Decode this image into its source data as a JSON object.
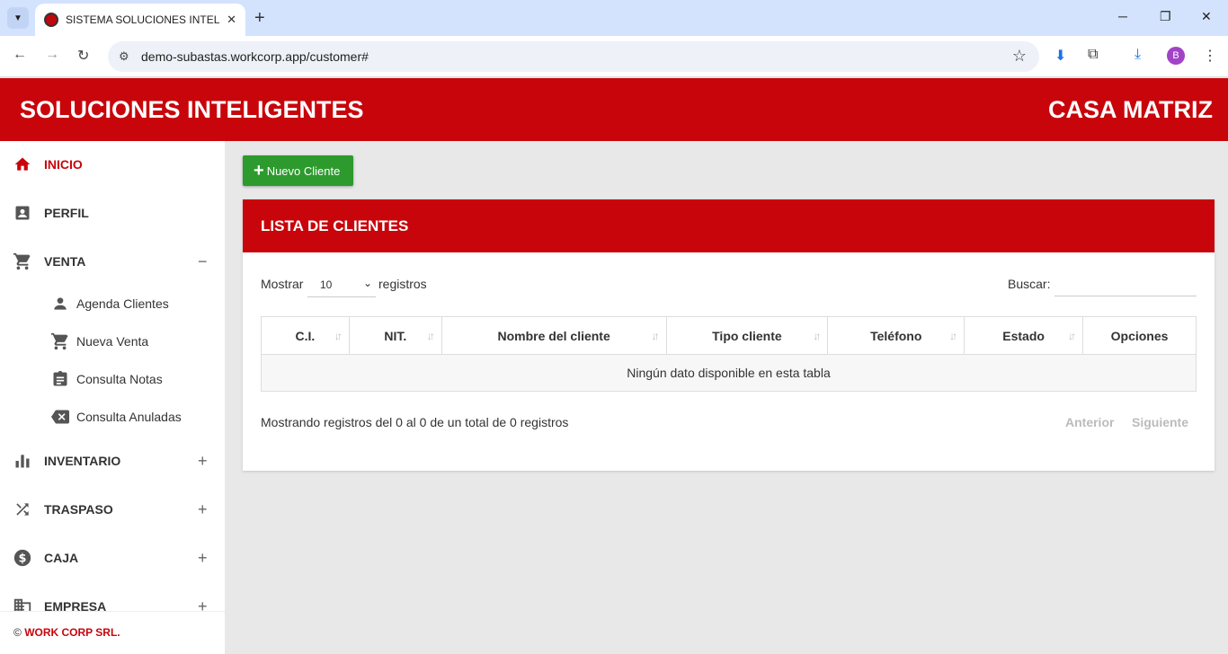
{
  "browser": {
    "tab_title": "SISTEMA SOLUCIONES INTELIGENTES",
    "url": "demo-subastas.workcorp.app/customer#",
    "profile_initial": "B"
  },
  "header": {
    "brand": "SOLUCIONES INTELIGENTES",
    "branch": "CASA MATRIZ",
    "accent_color": "#c8050b"
  },
  "sidebar": {
    "items": [
      {
        "label": "INICIO",
        "icon": "home-icon",
        "active": true
      },
      {
        "label": "PERFIL",
        "icon": "profile-card-icon"
      },
      {
        "label": "VENTA",
        "icon": "cart-icon",
        "toggle": "−",
        "children": [
          {
            "label": "Agenda Clientes",
            "icon": "person-icon"
          },
          {
            "label": "Nueva Venta",
            "icon": "cart-icon"
          },
          {
            "label": "Consulta Notas",
            "icon": "clipboard-icon"
          },
          {
            "label": "Consulta Anuladas",
            "icon": "backspace-x-icon"
          }
        ]
      },
      {
        "label": "INVENTARIO",
        "icon": "bar-chart-icon",
        "toggle": "+"
      },
      {
        "label": "TRASPASO",
        "icon": "shuffle-icon",
        "toggle": "+"
      },
      {
        "label": "CAJA",
        "icon": "dollar-circle-icon",
        "toggle": "+"
      },
      {
        "label": "EMPRESA",
        "icon": "building-icon",
        "toggle": "+"
      }
    ],
    "footer": {
      "copyright": "©",
      "company": "WORK CORP SRL."
    }
  },
  "main": {
    "new_button_label": "Nuevo Cliente",
    "card_title": "LISTA DE CLIENTES",
    "length_label_before": "Mostrar",
    "length_value": "10",
    "length_label_after": "registros",
    "search_label": "Buscar:",
    "table": {
      "columns": [
        "C.I.",
        "NIT.",
        "Nombre del cliente",
        "Tipo cliente",
        "Teléfono",
        "Estado",
        "Opciones"
      ],
      "empty_message": "Ningún dato disponible en esta tabla"
    },
    "info": "Mostrando registros del 0 al 0 de un total de 0 registros",
    "pagination": {
      "previous": "Anterior",
      "next": "Siguiente"
    },
    "button_color": "#2d9a2d"
  }
}
